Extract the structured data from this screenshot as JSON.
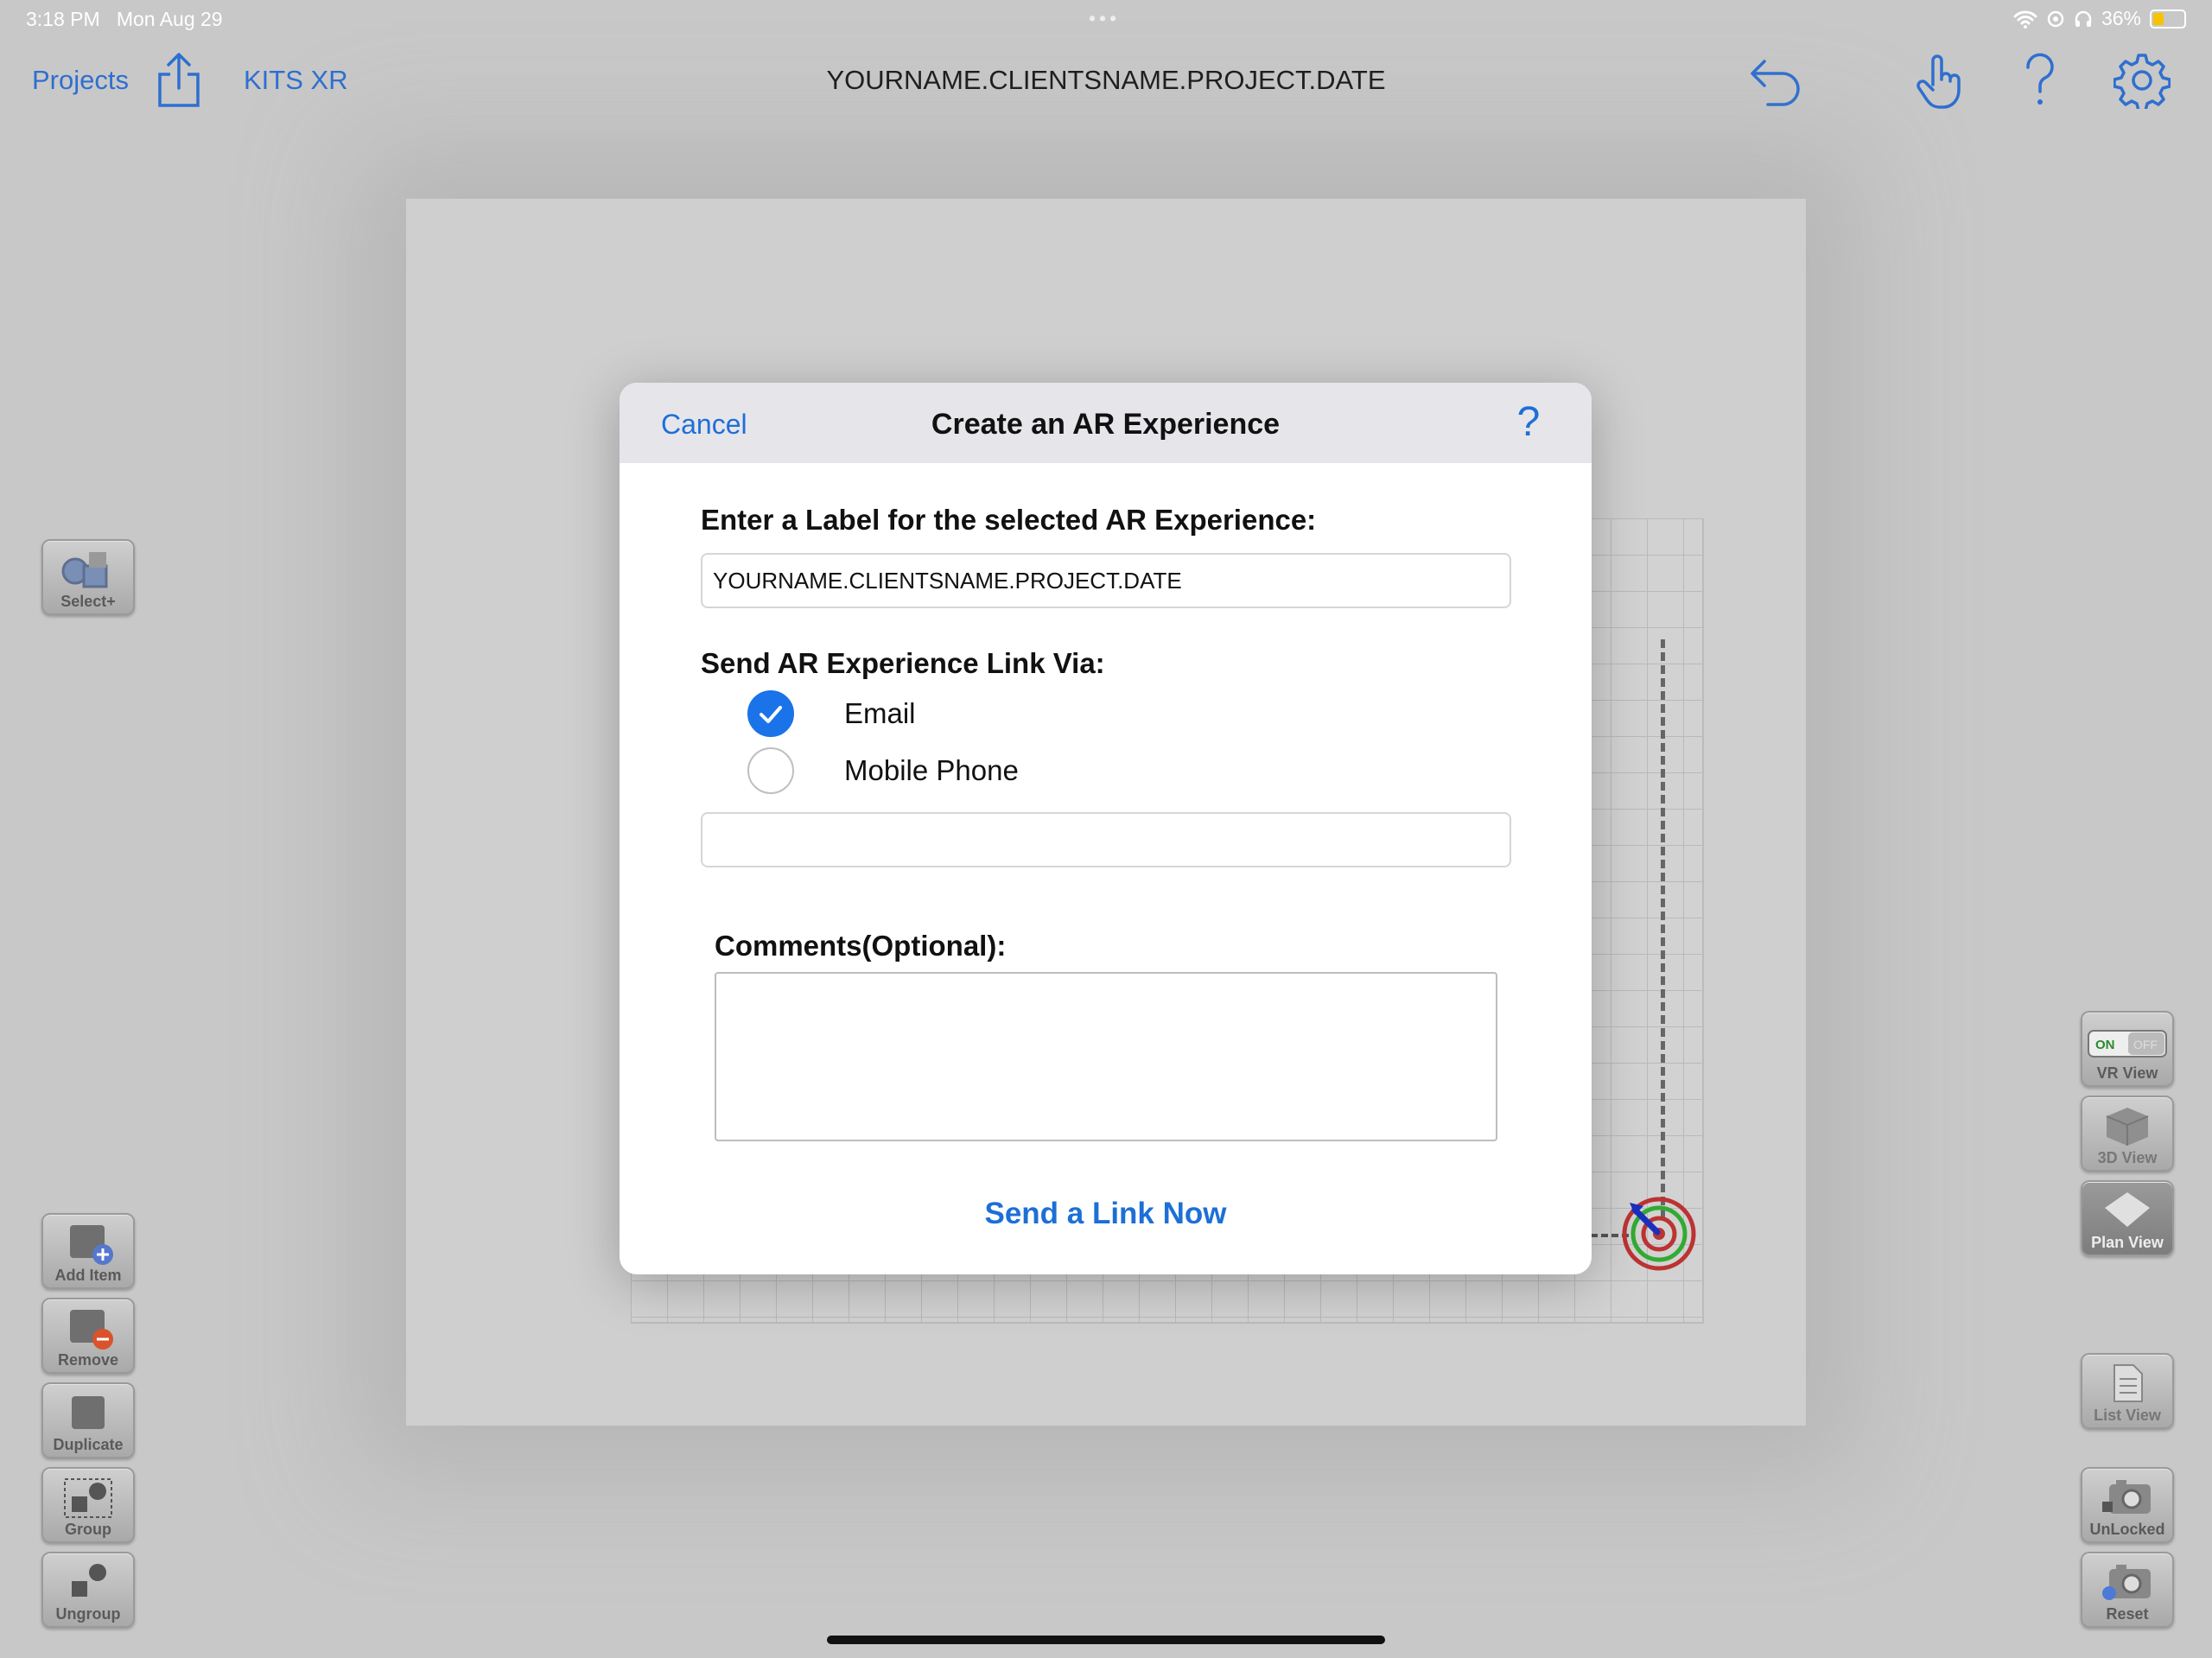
{
  "status": {
    "time": "3:18 PM",
    "date": "Mon Aug 29",
    "battery": "36%"
  },
  "nav": {
    "projects": "Projects",
    "kits": "KITS XR",
    "title": "YOURNAME.CLIENTSNAME.PROJECT.DATE"
  },
  "left_tools": {
    "select": "Select+",
    "add": "Add Item",
    "remove": "Remove",
    "duplicate": "Duplicate",
    "group": "Group",
    "ungroup": "Ungroup"
  },
  "right_tools": {
    "vr": "VR View",
    "vr_on": "ON",
    "vr_off": "OFF",
    "view3d": "3D View",
    "plan": "Plan View",
    "list": "List View",
    "unlocked": "UnLocked",
    "reset": "Reset"
  },
  "dialog": {
    "cancel": "Cancel",
    "title": "Create an AR Experience",
    "help": "?",
    "label_prompt": "Enter a Label for the selected AR Experience:",
    "label_value": "YOURNAME.CLIENTSNAME.PROJECT.DATE",
    "send_via": "Send AR Experience Link Via:",
    "option_email": "Email",
    "option_phone": "Mobile Phone",
    "contact_value": "",
    "comments_label": "Comments(Optional):",
    "comments_value": "",
    "send_button": "Send a Link Now"
  },
  "colors": {
    "accent": "#1d6fd6",
    "radio_selected": "#1a73e8",
    "backdrop": "#c8c8c8"
  }
}
